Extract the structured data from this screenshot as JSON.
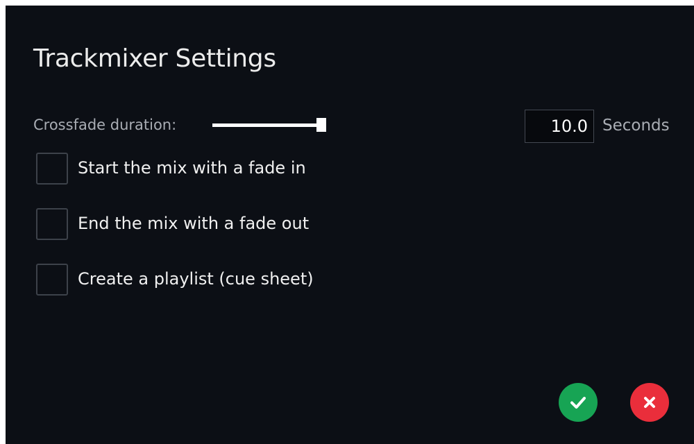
{
  "dialog": {
    "title": "Trackmixer Settings"
  },
  "crossfade": {
    "label": "Crossfade duration:",
    "slider_level_percent": 100,
    "value": "10.0",
    "unit": "Seconds"
  },
  "options": [
    {
      "label": "Start the mix with a fade in",
      "checked": false
    },
    {
      "label": "End the mix with a fade out",
      "checked": false
    },
    {
      "label": "Create a playlist (cue sheet)",
      "checked": false
    }
  ],
  "buttons": {
    "confirm_icon": "checkmark-icon",
    "cancel_icon": "close-icon",
    "confirm_color": "#17a454",
    "cancel_color": "#ea2e3b"
  },
  "colors": {
    "background": "#0c0f15",
    "text": "#f0f0f0",
    "muted_text": "#a9adb4"
  }
}
